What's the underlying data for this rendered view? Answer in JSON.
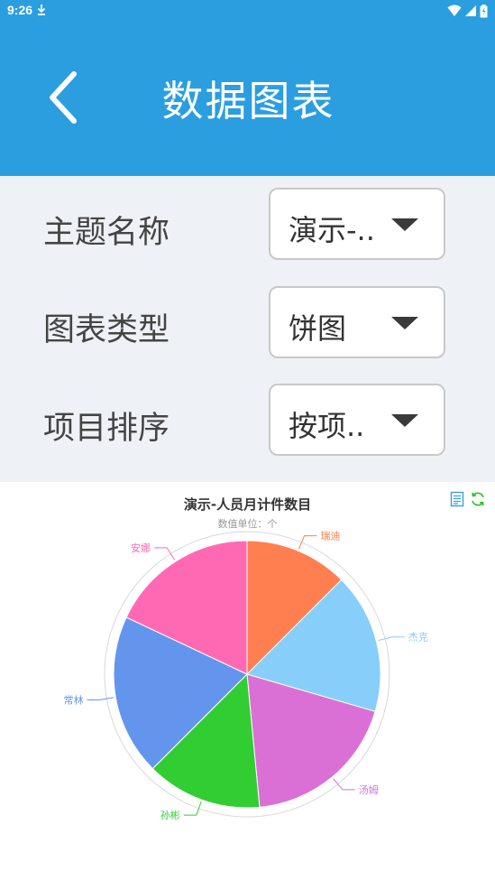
{
  "status_bar": {
    "time": "9:26",
    "icons": [
      "download-icon",
      "wifi-icon",
      "signal-icon",
      "battery-icon"
    ]
  },
  "header": {
    "title": "数据图表",
    "back_icon": "chevron-left-icon",
    "background": "#2b9ee0"
  },
  "form": {
    "fields": [
      {
        "label": "主题名称",
        "value": "演示-.."
      },
      {
        "label": "图表类型",
        "value": "饼图"
      },
      {
        "label": "项目排序",
        "value": "按项.."
      }
    ]
  },
  "chart_data": {
    "type": "pie",
    "title": "演示-人员月计件数目",
    "subtitle": "数值单位：个",
    "slices": [
      {
        "name": "瑞迪",
        "value": 12.5,
        "color": "#ff7f50"
      },
      {
        "name": "杰克",
        "value": 17,
        "color": "#87cefa"
      },
      {
        "name": "汤姆",
        "value": 19,
        "color": "#da70d6"
      },
      {
        "name": "孙彬",
        "value": 14,
        "color": "#32cd32"
      },
      {
        "name": "常林",
        "value": 19.5,
        "color": "#6495ed"
      },
      {
        "name": "安娜",
        "value": 18,
        "color": "#ff69b4"
      }
    ],
    "toolbox": [
      "data-view-icon",
      "restore-icon"
    ]
  }
}
